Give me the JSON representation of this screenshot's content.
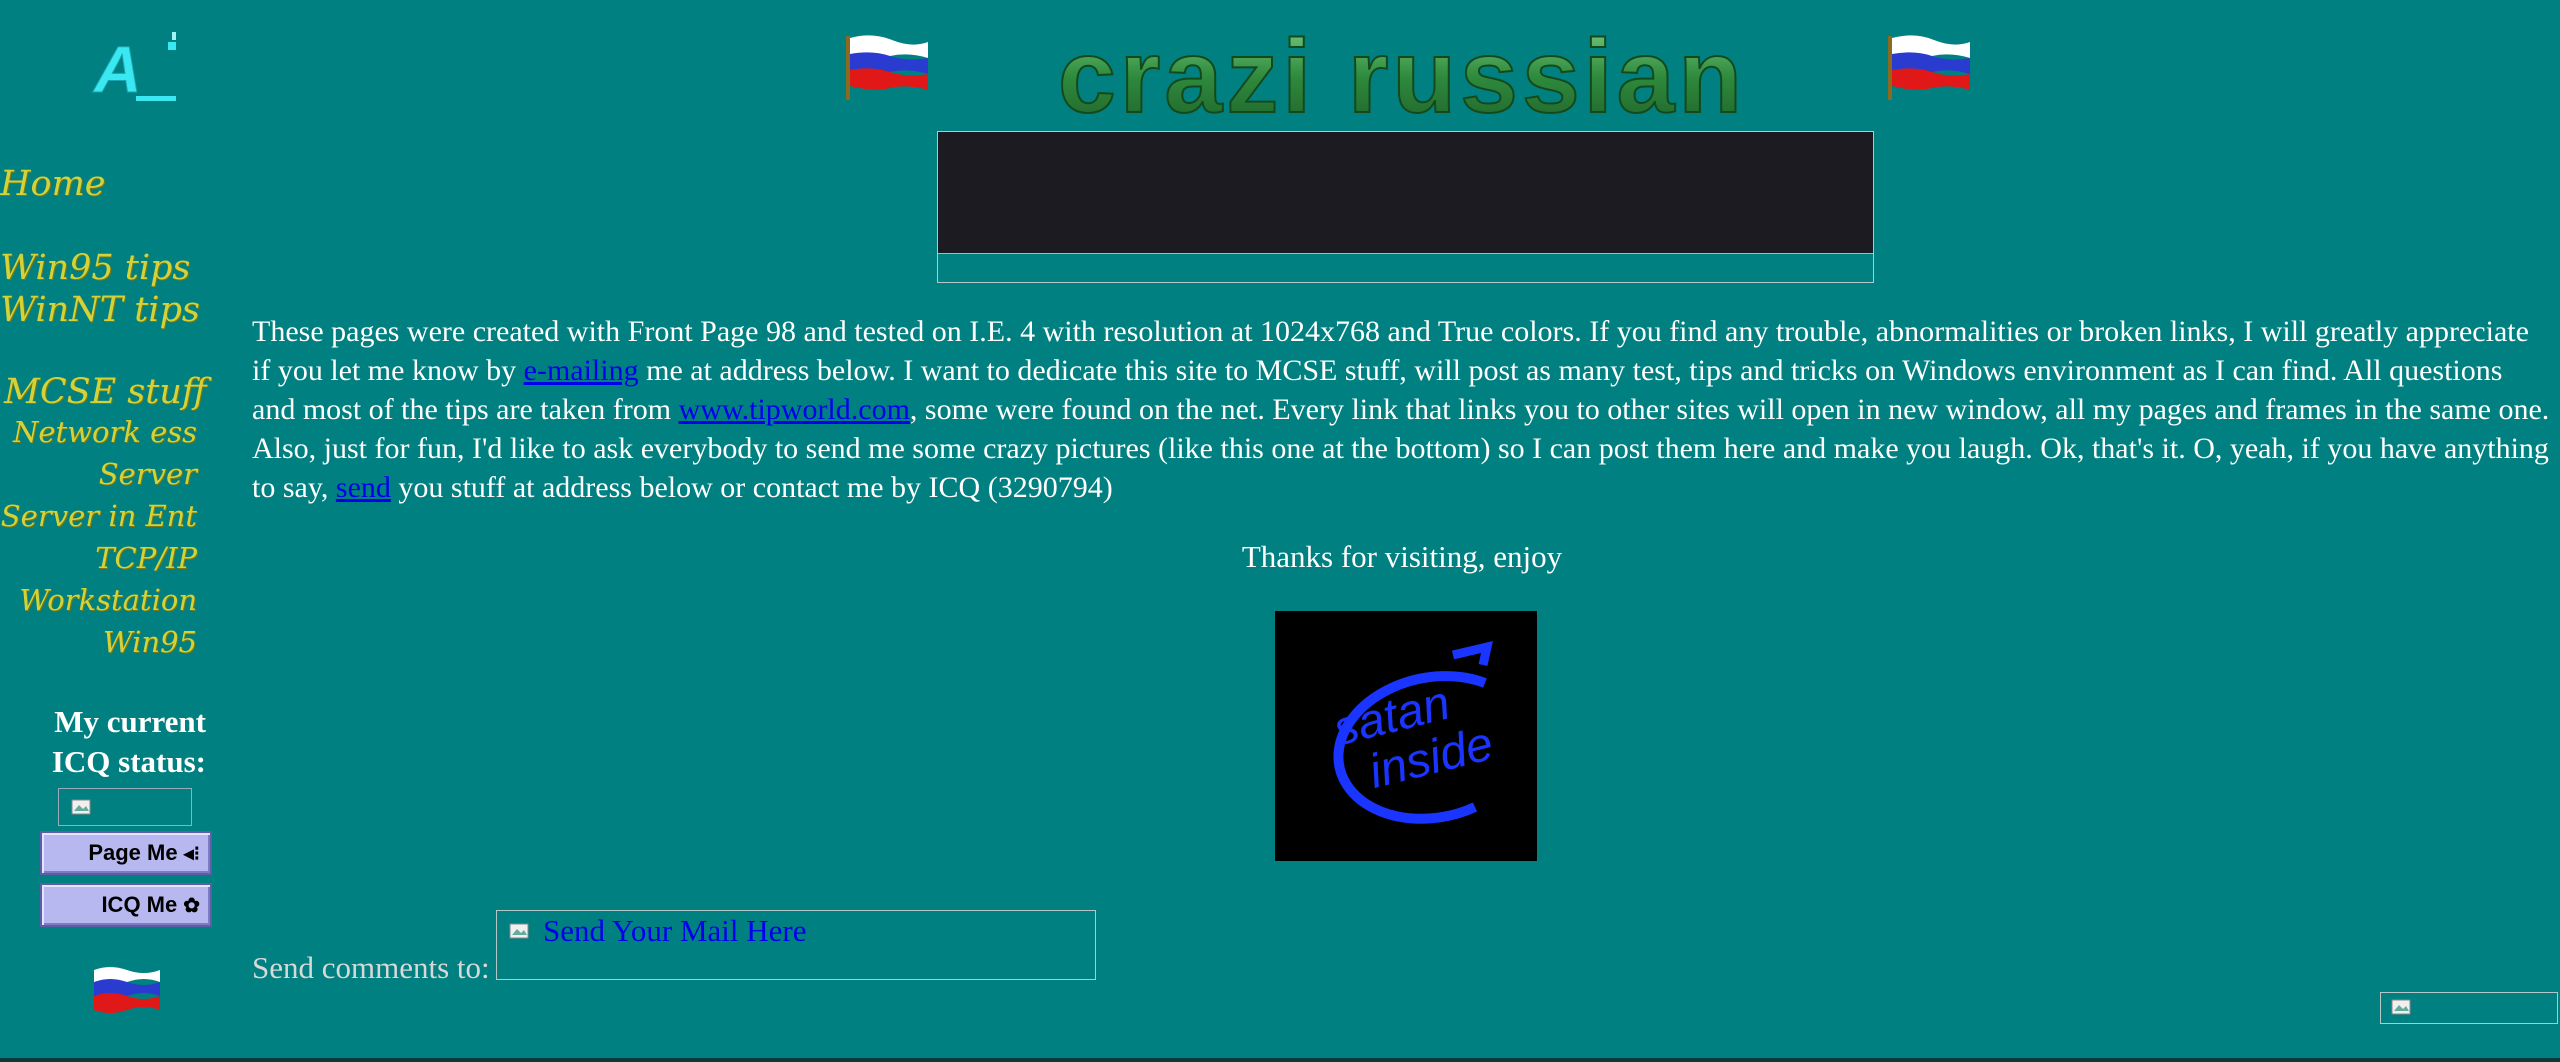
{
  "sidebar": {
    "logo_text": "A",
    "home": "Home",
    "win95_tips": "Win95 tips",
    "winnt_tips": "WinNT tips",
    "mcse_stuff": "MCSE stuff",
    "mcse_items": [
      "Network ess",
      "Server",
      "Server in Ent",
      "TCP/IP",
      "Workstation",
      "Win95"
    ],
    "icq_title_line1": "My current",
    "icq_title_line2": "ICQ status:",
    "page_me": "Page Me",
    "icq_me": "ICQ Me"
  },
  "header": {
    "wordart_title": "crazi russian"
  },
  "content": {
    "intro_part1": "These pages were created with Front Page 98 and tested on I.E. 4 with resolution at 1024x768 and True colors. If you find any trouble, abnormalities or broken links, I will greatly appreciate if you let me know by ",
    "link_emailing": "e-mailing",
    "intro_part2": " me at address below. I want to dedicate this site to MCSE stuff, will post as many test, tips and tricks on Windows environment as I can find. All questions and most of the tips are taken from ",
    "link_tipworld": "www.tipworld.com",
    "intro_part3": ", some were found on the net. Every link that links you to other sites will open in new window, all my pages and frames in the same one. Also, just for fun, I'd like to ask everybody to send me some crazy pictures (like this one at the bottom) so I can post them here and make you laugh. Ok, that's it. O, yeah, if you have anything to say, ",
    "link_send": "send",
    "intro_part4": " you stuff at address below or contact me by ICQ (3290794)",
    "thanks": "Thanks for visiting, enjoy",
    "satan_line1": "satan",
    "satan_line2": "inside",
    "send_comments_label": "Send comments to:",
    "mail_link": "Send Your Mail Here"
  },
  "colors": {
    "background": "#008080",
    "nav_text": "#d4d23a",
    "link": "#0000ee",
    "satan_logo": "#1a35ff"
  }
}
